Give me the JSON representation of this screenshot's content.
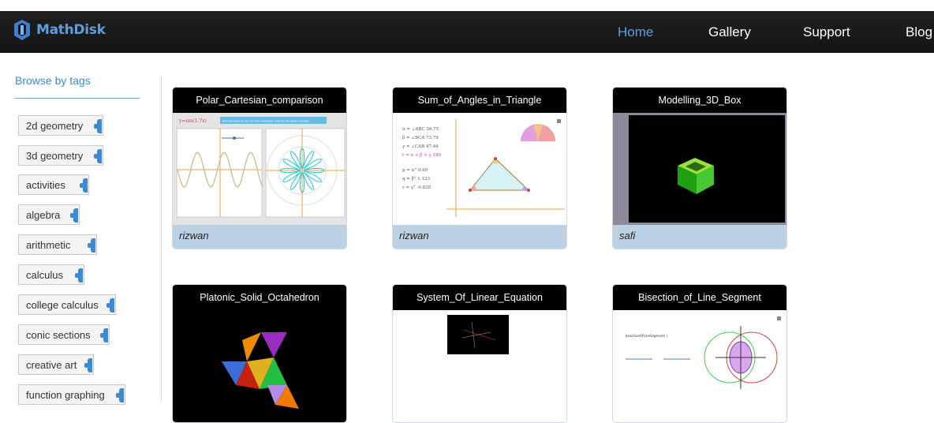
{
  "app": {
    "name": "MathDisk",
    "colors": {
      "accent": "#5b9ee0",
      "topbar": "#1a1a1a",
      "tag_tab": "#3b8ad8",
      "author_bar": "#bcd1e3"
    }
  },
  "nav": {
    "items": [
      {
        "label": "Home",
        "active": true
      },
      {
        "label": "Gallery",
        "active": false
      },
      {
        "label": "Support",
        "active": false
      },
      {
        "label": "Blog",
        "active": false
      }
    ]
  },
  "sidebar": {
    "title": "Browse by tags",
    "tags": [
      "2d geometry",
      "3d geometry",
      "activities",
      "algebra",
      "arithmetic",
      "calculus",
      "college calculus",
      "conic sections",
      "creative art",
      "function graphing"
    ]
  },
  "gallery": {
    "cards": [
      {
        "title": "Polar_Cartesian_comparison",
        "author": "rizwan",
        "thumb": "polar"
      },
      {
        "title": "Sum_of_Angles_in_Triangle",
        "author": "rizwan",
        "thumb": "triangle"
      },
      {
        "title": "Modelling_3D_Box",
        "author": "safi",
        "thumb": "box"
      },
      {
        "title": "Platonic_Solid_Octahedron",
        "author": "",
        "thumb": "octahedron"
      },
      {
        "title": "System_Of_Linear_Equation",
        "author": "",
        "thumb": "linear"
      },
      {
        "title": "Bisection_of_Line_Segment",
        "author": "",
        "thumb": "bisection"
      }
    ],
    "thumb_text": {
      "polar_equation": "y=sin(1.7x)",
      "polar_banner": "Edit the equation by click the expression and see the graph changes",
      "triangle_stats": [
        "α = ∠ABC   56.75",
        "β = ∠BCA   73.79",
        "γ = ∠CAB   47.46",
        "t = α + β + γ   180",
        "p = α°   0.99",
        "q = β°   1.123",
        "r = γ°   -0.828"
      ],
      "bisection_label": "bisectionOfLineSegment( )"
    }
  }
}
